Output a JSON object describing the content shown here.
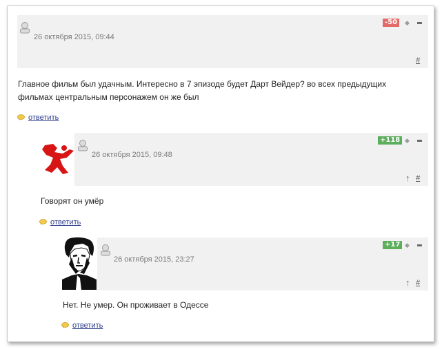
{
  "comments": [
    {
      "date": "26 октября 2015, 09:44",
      "rating": "-50",
      "rating_color": "#e36a6a",
      "text_line1": "Главное фильм был удачным. Интересно в 7 эпизоде будет Дарт Вейдер? во всех предыдущих",
      "text_line2": "фильмах центральным персонажем он же был",
      "reply_label": "ответить",
      "hash_label": "#"
    },
    {
      "date": "26 октября 2015, 09:48",
      "rating": "+118",
      "rating_color": "#5cad5c",
      "text": "Говорят он умёр",
      "reply_label": "ответить",
      "up_label": "↑",
      "hash_label": "#",
      "avatar": "red-running-figure"
    },
    {
      "date": "26 октября 2015, 23:27",
      "rating": "+17",
      "rating_color": "#5cad5c",
      "text": "Нет. Не умер. Он проживает в Одессе",
      "reply_label": "ответить",
      "up_label": "↑",
      "hash_label": "#",
      "avatar": "black-white-portrait"
    }
  ],
  "icons": {
    "user": "user-icon",
    "vote": "vote-icon",
    "minus": "minus-icon",
    "reply": "speech-bubble-icon"
  }
}
